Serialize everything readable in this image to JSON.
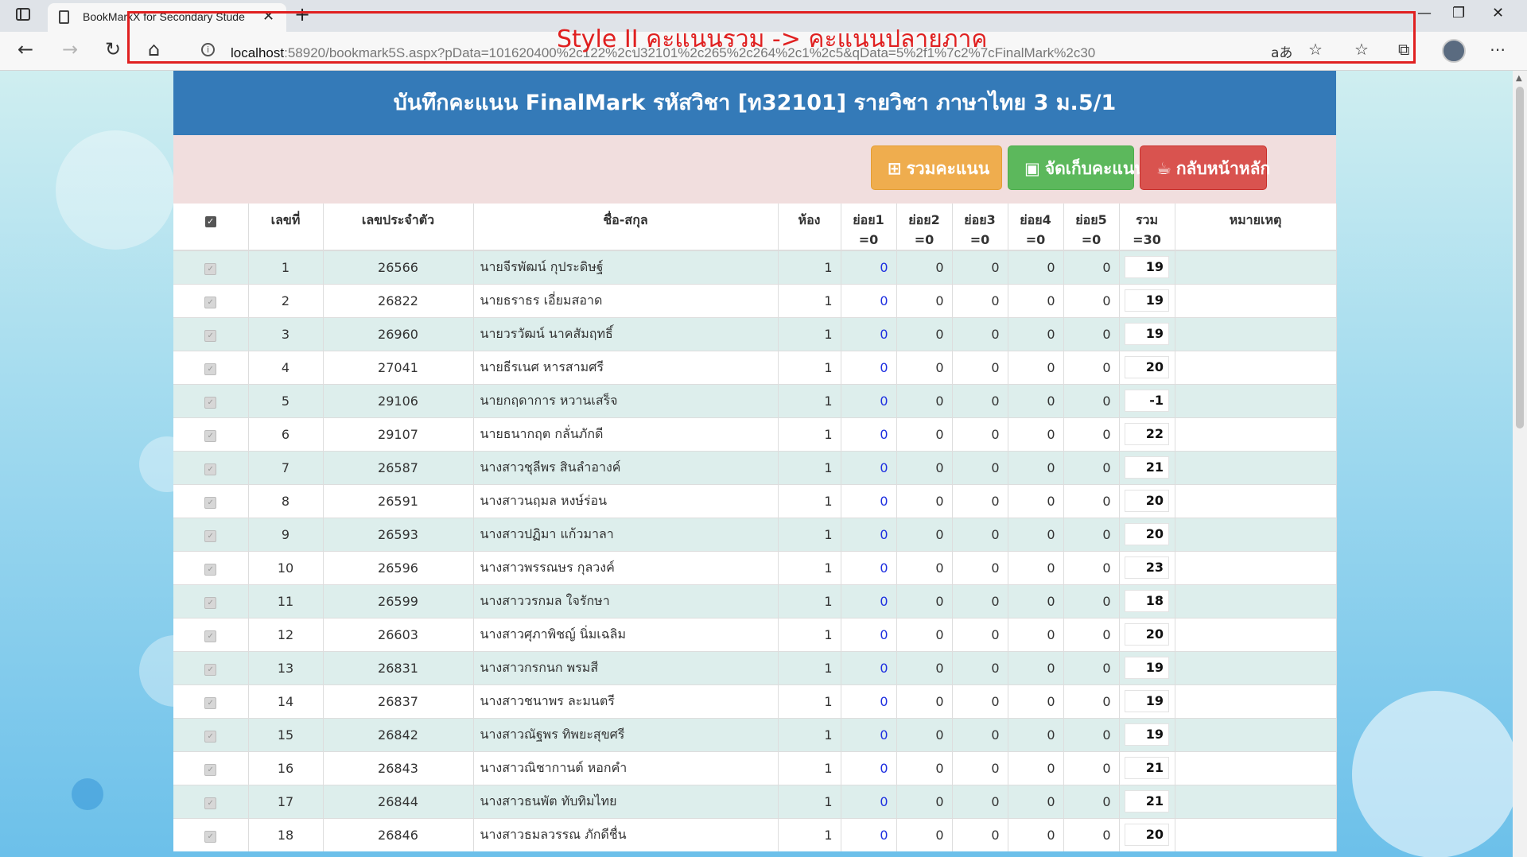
{
  "browser": {
    "tab_title": "BookMarkX for Secondary Stude",
    "tab_close": "✕",
    "new_tab": "+",
    "url_host": "localhost",
    "url_rest": ":58920/bookmark5S.aspx?pData=101620400%2c122%2cป32101%2c265%2c264%2c1%2c5&qData=5%2f1%7c2%7cFinalMark%2c30",
    "annotation": "Style II คะแนนรวม -> คะแนนปลายภาค",
    "read_aloud": "aあ"
  },
  "header": {
    "title": "บันทึกคะแนน FinalMark รหัสวิชา [ท32101] รายวิชา ภาษาไทย 3 ม.5/1"
  },
  "toolbar": {
    "sum_label": "รวมคะแนน",
    "save_label": "จัดเก็บคะแนน",
    "home_label": "กลับหน้าหลัก"
  },
  "table": {
    "headers": {
      "no": "เลขที่",
      "id": "เลขประจำตัว",
      "name": "ชื่อ-สกุล",
      "room": "ห้อง",
      "sub1": "ย่อย1",
      "sub1_max": "=0",
      "sub2": "ย่อย2",
      "sub2_max": "=0",
      "sub3": "ย่อย3",
      "sub3_max": "=0",
      "sub4": "ย่อย4",
      "sub4_max": "=0",
      "sub5": "ย่อย5",
      "sub5_max": "=0",
      "total": "รวม",
      "total_max": "=30",
      "note": "หมายเหตุ"
    },
    "rows": [
      {
        "no": "1",
        "id": "26566",
        "name": "นายจีรพัฒน์ กุประดิษฐ์",
        "room": "1",
        "s1": "0",
        "s2": "0",
        "s3": "0",
        "s4": "0",
        "s5": "0",
        "total": "19"
      },
      {
        "no": "2",
        "id": "26822",
        "name": "นายธราธร เอี่ยมสอาด",
        "room": "1",
        "s1": "0",
        "s2": "0",
        "s3": "0",
        "s4": "0",
        "s5": "0",
        "total": "19"
      },
      {
        "no": "3",
        "id": "26960",
        "name": "นายวรวัฒน์ นาคสัมฤทธิ์",
        "room": "1",
        "s1": "0",
        "s2": "0",
        "s3": "0",
        "s4": "0",
        "s5": "0",
        "total": "19"
      },
      {
        "no": "4",
        "id": "27041",
        "name": "นายธีรเนศ หารสามศรี",
        "room": "1",
        "s1": "0",
        "s2": "0",
        "s3": "0",
        "s4": "0",
        "s5": "0",
        "total": "20"
      },
      {
        "no": "5",
        "id": "29106",
        "name": "นายกฤดาการ หวานเสร็จ",
        "room": "1",
        "s1": "0",
        "s2": "0",
        "s3": "0",
        "s4": "0",
        "s5": "0",
        "total": "-1"
      },
      {
        "no": "6",
        "id": "29107",
        "name": "นายธนากฤต กลั่นภักดี",
        "room": "1",
        "s1": "0",
        "s2": "0",
        "s3": "0",
        "s4": "0",
        "s5": "0",
        "total": "22"
      },
      {
        "no": "7",
        "id": "26587",
        "name": "นางสาวชุลีพร สินลำอางค์",
        "room": "1",
        "s1": "0",
        "s2": "0",
        "s3": "0",
        "s4": "0",
        "s5": "0",
        "total": "21"
      },
      {
        "no": "8",
        "id": "26591",
        "name": "นางสาวนฤมล หงษ์ร่อน",
        "room": "1",
        "s1": "0",
        "s2": "0",
        "s3": "0",
        "s4": "0",
        "s5": "0",
        "total": "20"
      },
      {
        "no": "9",
        "id": "26593",
        "name": "นางสาวปฏิมา แก้วมาลา",
        "room": "1",
        "s1": "0",
        "s2": "0",
        "s3": "0",
        "s4": "0",
        "s5": "0",
        "total": "20"
      },
      {
        "no": "10",
        "id": "26596",
        "name": "นางสาวพรรณษร กุลวงค์",
        "room": "1",
        "s1": "0",
        "s2": "0",
        "s3": "0",
        "s4": "0",
        "s5": "0",
        "total": "23"
      },
      {
        "no": "11",
        "id": "26599",
        "name": "นางสาววรกมล ใจรักษา",
        "room": "1",
        "s1": "0",
        "s2": "0",
        "s3": "0",
        "s4": "0",
        "s5": "0",
        "total": "18"
      },
      {
        "no": "12",
        "id": "26603",
        "name": "นางสาวศุภาพิชญ์ นิ่มเฉลิม",
        "room": "1",
        "s1": "0",
        "s2": "0",
        "s3": "0",
        "s4": "0",
        "s5": "0",
        "total": "20"
      },
      {
        "no": "13",
        "id": "26831",
        "name": "นางสาวกรกนก พรมสี",
        "room": "1",
        "s1": "0",
        "s2": "0",
        "s3": "0",
        "s4": "0",
        "s5": "0",
        "total": "19"
      },
      {
        "no": "14",
        "id": "26837",
        "name": "นางสาวชนาพร ละมนตรี",
        "room": "1",
        "s1": "0",
        "s2": "0",
        "s3": "0",
        "s4": "0",
        "s5": "0",
        "total": "19"
      },
      {
        "no": "15",
        "id": "26842",
        "name": "นางสาวณัฐพร ทิพยะสุขศรี",
        "room": "1",
        "s1": "0",
        "s2": "0",
        "s3": "0",
        "s4": "0",
        "s5": "0",
        "total": "19"
      },
      {
        "no": "16",
        "id": "26843",
        "name": "นางสาวณิชากานต์ หอกคำ",
        "room": "1",
        "s1": "0",
        "s2": "0",
        "s3": "0",
        "s4": "0",
        "s5": "0",
        "total": "21"
      },
      {
        "no": "17",
        "id": "26844",
        "name": "นางสาวธนพัต ทับทิมไทย",
        "room": "1",
        "s1": "0",
        "s2": "0",
        "s3": "0",
        "s4": "0",
        "s5": "0",
        "total": "21"
      },
      {
        "no": "18",
        "id": "26846",
        "name": "นางสาวธมลวรรณ ภักดีชื่น",
        "room": "1",
        "s1": "0",
        "s2": "0",
        "s3": "0",
        "s4": "0",
        "s5": "0",
        "total": "20"
      }
    ]
  },
  "colors": {
    "header_bg": "#347ab8",
    "toolbar_bg": "#f1dede",
    "btn_sum": "#efad4e",
    "btn_save": "#5cb85c",
    "btn_home": "#d9534f",
    "row_alt": "#ddeeec",
    "sub1_text": "#1e2fe0",
    "annotation": "#e02020"
  },
  "icons": {
    "sum": "plus-square-icon",
    "save": "floppy-disk-icon",
    "home": "cup-icon"
  }
}
